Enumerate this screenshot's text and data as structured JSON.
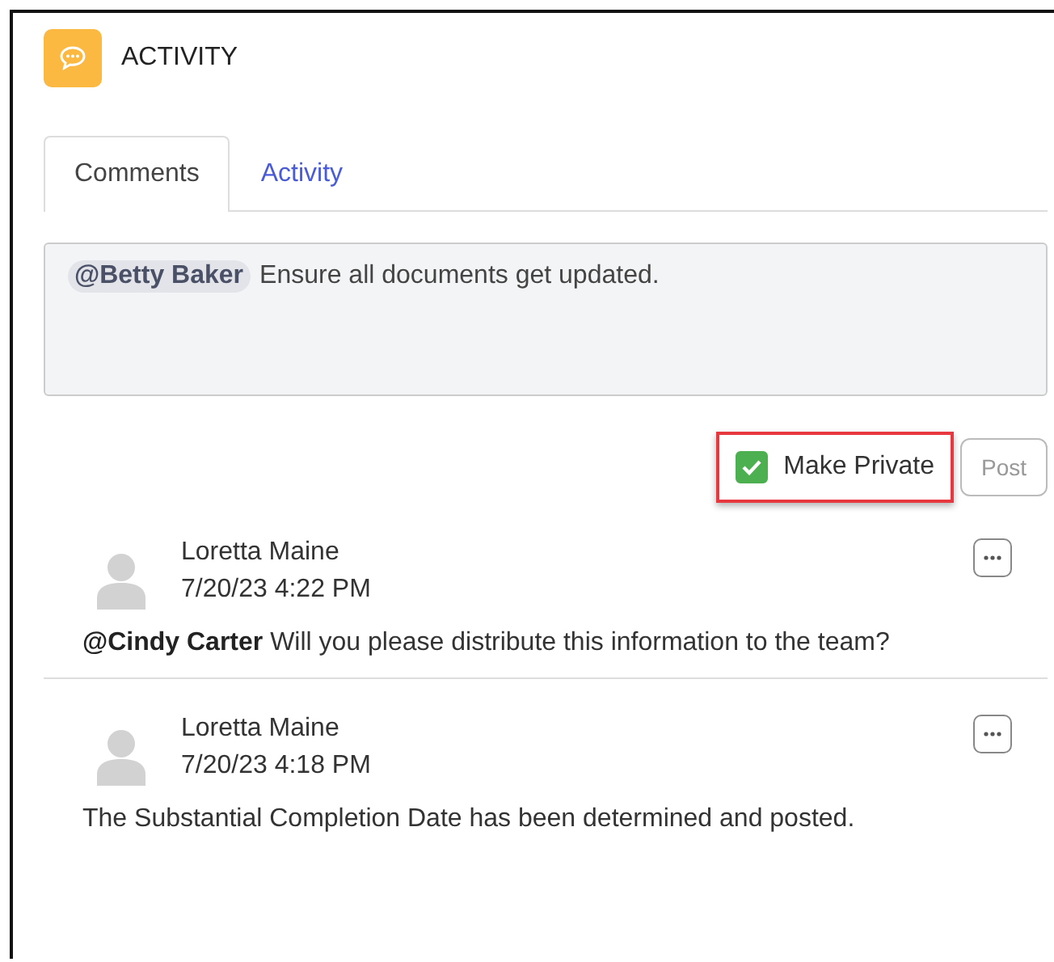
{
  "header": {
    "title": "ACTIVITY"
  },
  "tabs": [
    {
      "label": "Comments",
      "selected": true
    },
    {
      "label": "Activity",
      "selected": false
    }
  ],
  "composer": {
    "mention": "@Betty Baker",
    "text": "Ensure all documents get updated."
  },
  "private_checkbox": {
    "label": "Make Private",
    "checked": true,
    "highlighted": true
  },
  "post_button": {
    "label": "Post",
    "disabled": true
  },
  "comments": [
    {
      "author": "Loretta Maine",
      "time": "7/20/23 4:22 PM",
      "text": "**@Cindy Carter** Will you please distribute this information to the team?"
    },
    {
      "author": "Loretta Maine",
      "time": "7/20/23 4:18 PM",
      "text": "The Substantial Completion Date has been determined and posted."
    }
  ]
}
